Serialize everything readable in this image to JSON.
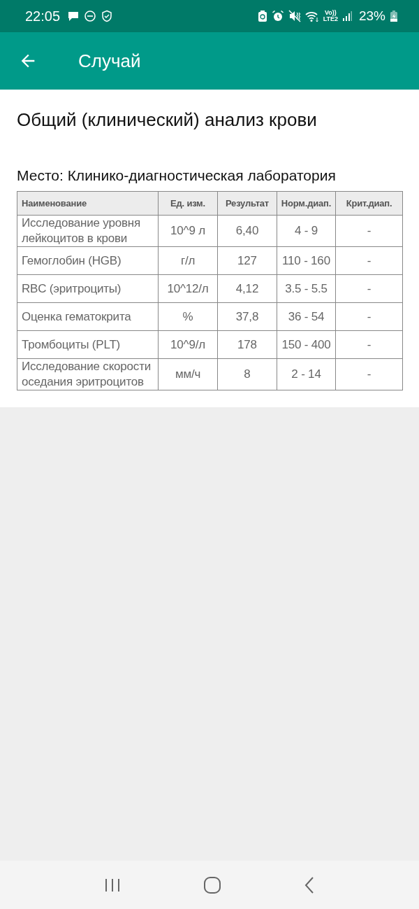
{
  "status_bar": {
    "time": "22:05",
    "network_top": "Vo))",
    "network_bottom": "LTE2",
    "battery": "23%"
  },
  "app_bar": {
    "title": "Случай"
  },
  "heading": "Общий (клинический) анализ крови",
  "place": "Место: Клинико-диагностическая лаборатория",
  "table": {
    "columns": [
      "Наименование",
      "Ед. изм.",
      "Результат",
      "Норм.диап.",
      "Крит.диап."
    ],
    "rows": [
      [
        "Исследование уровня лейкоцитов в крови",
        "10^9 л",
        "6,40",
        "4 - 9",
        "-"
      ],
      [
        "Гемоглобин (HGB)",
        "г/л",
        "127",
        "110 - 160",
        "-"
      ],
      [
        "RBC (эритроциты)",
        "10^12/л",
        "4,12",
        "3.5 - 5.5",
        "-"
      ],
      [
        "Оценка гематокрита",
        "%",
        "37,8",
        "36 - 54",
        "-"
      ],
      [
        "Тромбоциты (PLT)",
        "10^9/л",
        "178",
        "150 - 400",
        "-"
      ],
      [
        "Исследование скорости оседания эритроцитов",
        "мм/ч",
        "8",
        "2 - 14",
        "-"
      ]
    ]
  }
}
